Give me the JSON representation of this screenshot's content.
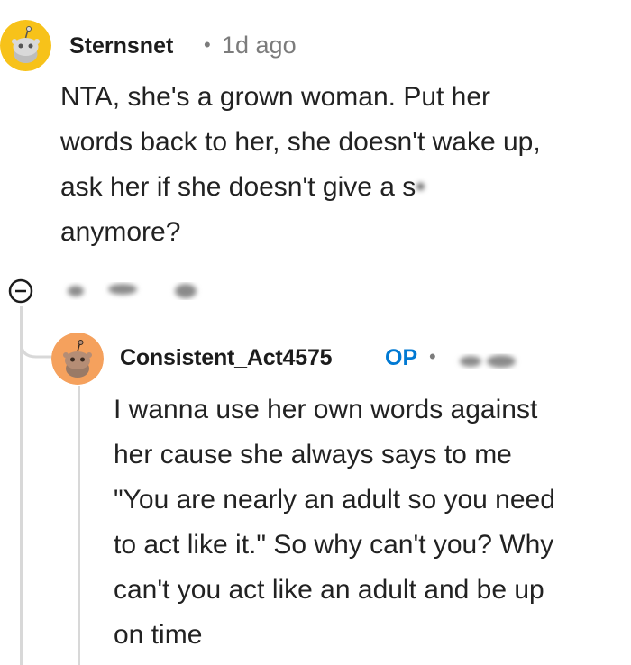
{
  "comments": [
    {
      "username": "Sternsnet",
      "separator": "•",
      "time": "1d ago",
      "body_lines": [
        "NTA, she's a grown woman. Put her",
        "words back to her, she doesn't wake up,",
        "ask her if she doesn't give a s",
        "anymore?"
      ],
      "avatar_color": "#f7c21a"
    },
    {
      "username": "Consistent_Act4575",
      "op_badge": "OP",
      "separator": "•",
      "body_lines": [
        "I wanna use her own words against",
        "her cause she always says to me",
        "\"You are nearly an adult so you need",
        "to act like it.\" So why can't you? Why",
        "can't you act like an adult and be up",
        "on time"
      ],
      "avatar_color": "#f5a15d"
    }
  ],
  "colors": {
    "op_blue": "#0079d3",
    "meta_gray": "#7c7c7c",
    "thread_line": "#d8d8d8"
  },
  "icons": {
    "collapse": "collapse-minus-icon",
    "avatar": "snoo-avatar-icon"
  }
}
